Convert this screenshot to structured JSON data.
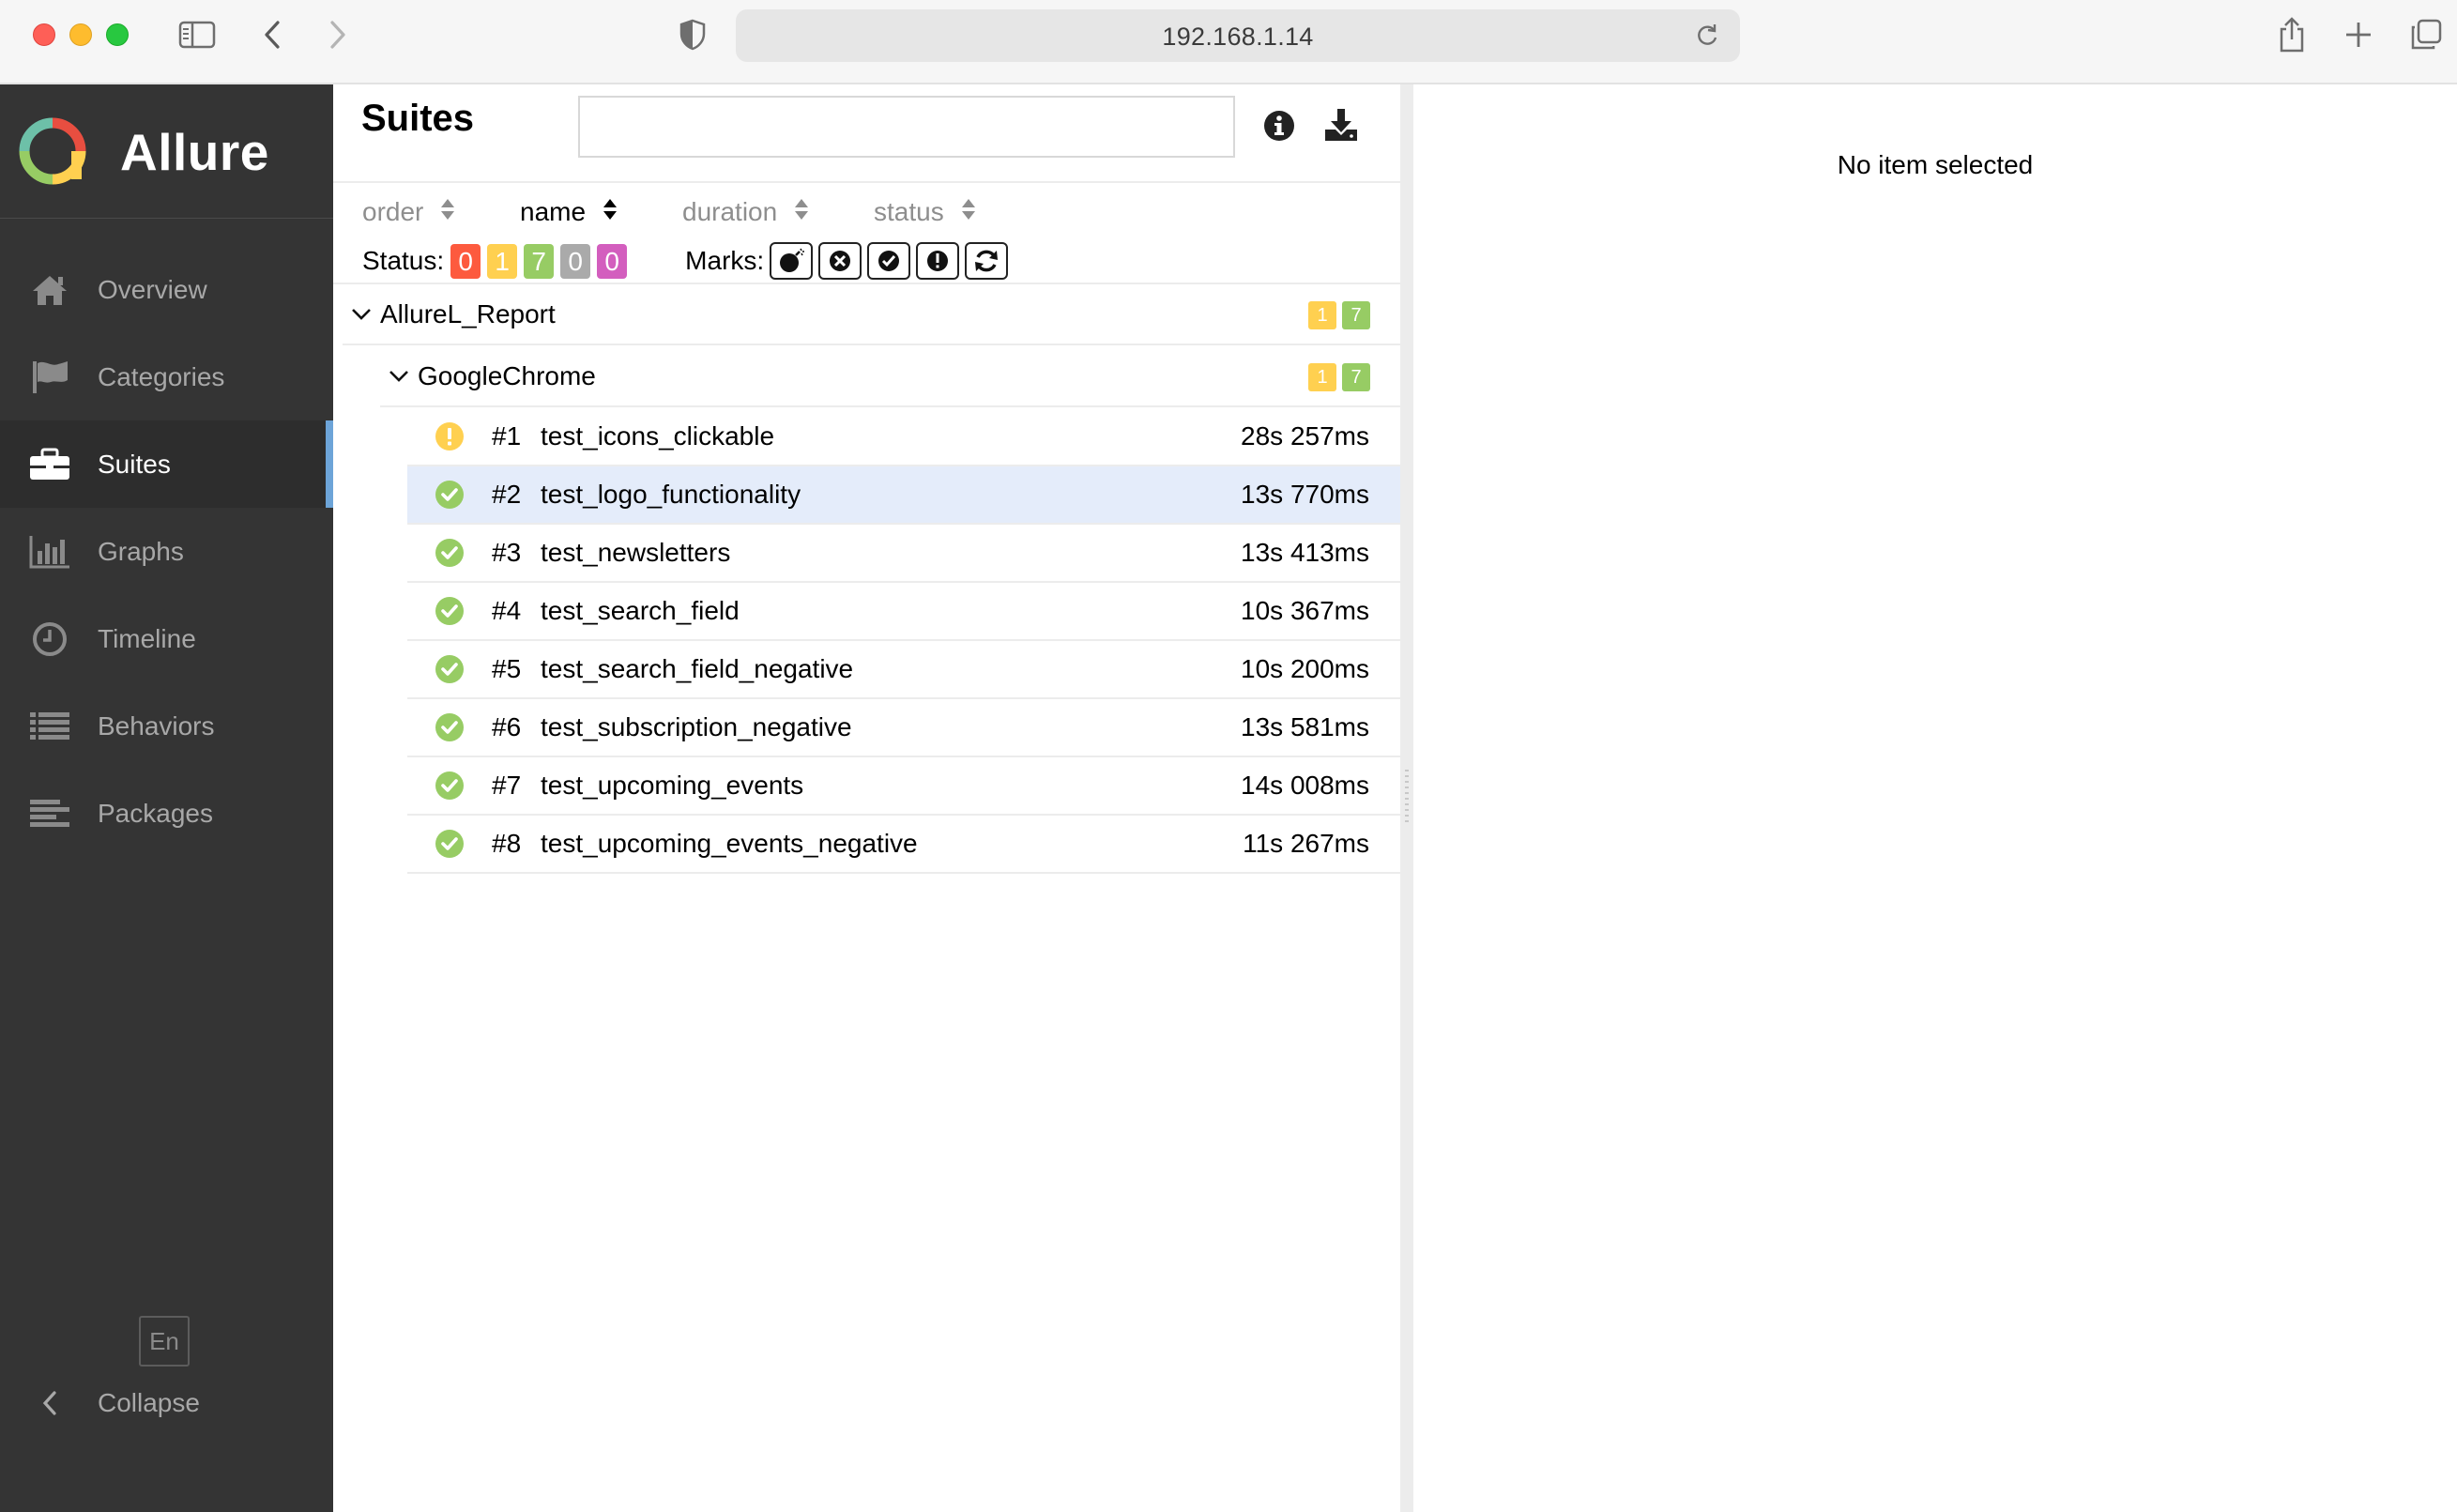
{
  "browser": {
    "url": "192.168.1.14"
  },
  "sidebar": {
    "brand": "Allure",
    "items": [
      {
        "label": "Overview",
        "icon": "home-icon"
      },
      {
        "label": "Categories",
        "icon": "flag-icon"
      },
      {
        "label": "Suites",
        "icon": "briefcase-icon",
        "active": true
      },
      {
        "label": "Graphs",
        "icon": "bar-chart-icon"
      },
      {
        "label": "Timeline",
        "icon": "clock-icon"
      },
      {
        "label": "Behaviors",
        "icon": "list-icon"
      },
      {
        "label": "Packages",
        "icon": "align-left-icon"
      }
    ],
    "language": "En",
    "collapse_label": "Collapse"
  },
  "suites": {
    "title": "Suites",
    "search_value": "",
    "sort": {
      "order": "order",
      "name": "name",
      "duration": "duration",
      "status": "status"
    },
    "status_label": "Status:",
    "status_counts": {
      "failed": "0",
      "broken": "1",
      "passed": "7",
      "skipped": "0",
      "unknown": "0"
    },
    "marks_label": "Marks:",
    "tree": {
      "root": {
        "name": "AllureL_Report",
        "broken": "1",
        "passed": "7"
      },
      "child": {
        "name": "GoogleChrome",
        "broken": "1",
        "passed": "7"
      }
    },
    "tests": [
      {
        "num": "#1",
        "name": "test_icons_clickable",
        "duration": "28s 257ms",
        "status": "broken"
      },
      {
        "num": "#2",
        "name": "test_logo_functionality",
        "duration": "13s 770ms",
        "status": "passed",
        "selected": true
      },
      {
        "num": "#3",
        "name": "test_newsletters",
        "duration": "13s 413ms",
        "status": "passed"
      },
      {
        "num": "#4",
        "name": "test_search_field",
        "duration": "10s 367ms",
        "status": "passed"
      },
      {
        "num": "#5",
        "name": "test_search_field_negative",
        "duration": "10s 200ms",
        "status": "passed"
      },
      {
        "num": "#6",
        "name": "test_subscription_negative",
        "duration": "13s 581ms",
        "status": "passed"
      },
      {
        "num": "#7",
        "name": "test_upcoming_events",
        "duration": "14s 008ms",
        "status": "passed"
      },
      {
        "num": "#8",
        "name": "test_upcoming_events_negative",
        "duration": "11s 267ms",
        "status": "passed"
      }
    ]
  },
  "detail": {
    "empty_text": "No item selected"
  },
  "colors": {
    "failed": "#fd5a3e",
    "broken": "#ffd050",
    "passed": "#97cc64",
    "skipped": "#aaaaaa",
    "unknown": "#d35ebe",
    "sidebar_bg": "#343434",
    "active_accent": "#6da4d8",
    "selected_row": "#e4ecfa"
  }
}
